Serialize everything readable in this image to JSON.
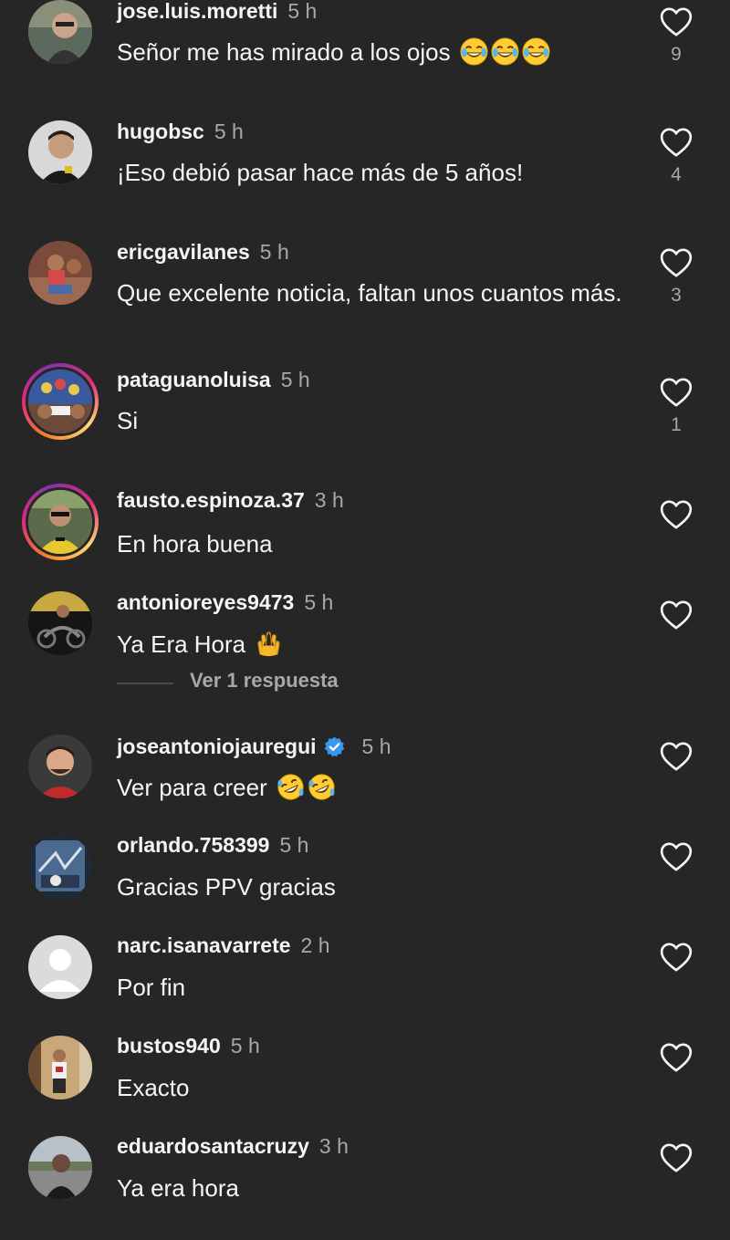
{
  "comments": [
    {
      "username": "jose.luis.moretti",
      "time": "5 h",
      "text": "Señor me has mirado a los ojos",
      "emoji": "😂😂😂",
      "likes": "9"
    },
    {
      "username": "hugobsc",
      "time": "5 h",
      "text": "¡Eso debió pasar hace más de 5 años!",
      "likes": "4"
    },
    {
      "username": "ericgavilanes",
      "time": "5 h",
      "text": "Que excelente noticia, faltan unos cuantos más.",
      "likes": "3"
    },
    {
      "username": "pataguanoluisa",
      "time": "5 h",
      "text": "Si",
      "likes": "1"
    },
    {
      "username": "fausto.espinoza.37",
      "time": "3 h",
      "text": "En hora buena"
    },
    {
      "username": "antonioreyes9473",
      "time": "5 h",
      "text": "Ya Era Hora",
      "emoji": "🙌",
      "replies_label": "Ver 1 respuesta"
    },
    {
      "username": "joseantoniojauregui",
      "time": "5 h",
      "text": "Ver para creer",
      "emoji": "🤣🤣",
      "verified": true
    },
    {
      "username": "orlando.758399",
      "time": "5 h",
      "text": "Gracias PPV gracias"
    },
    {
      "username": "narc.isanavarrete",
      "time": "2 h",
      "text": "Por fin"
    },
    {
      "username": "bustos940",
      "time": "5 h",
      "text": "Exacto"
    },
    {
      "username": "eduardosantacruzy",
      "time": "3 h",
      "text": "Ya era hora"
    }
  ],
  "icons": {
    "like": "heart-outline-icon",
    "verified": "verified-badge-icon"
  },
  "colors": {
    "background": "#262626",
    "primary_text": "#f5f5f5",
    "secondary_text": "#a8a8a8",
    "verified": "#3897f0",
    "story_ring": "#dd2a7b"
  }
}
